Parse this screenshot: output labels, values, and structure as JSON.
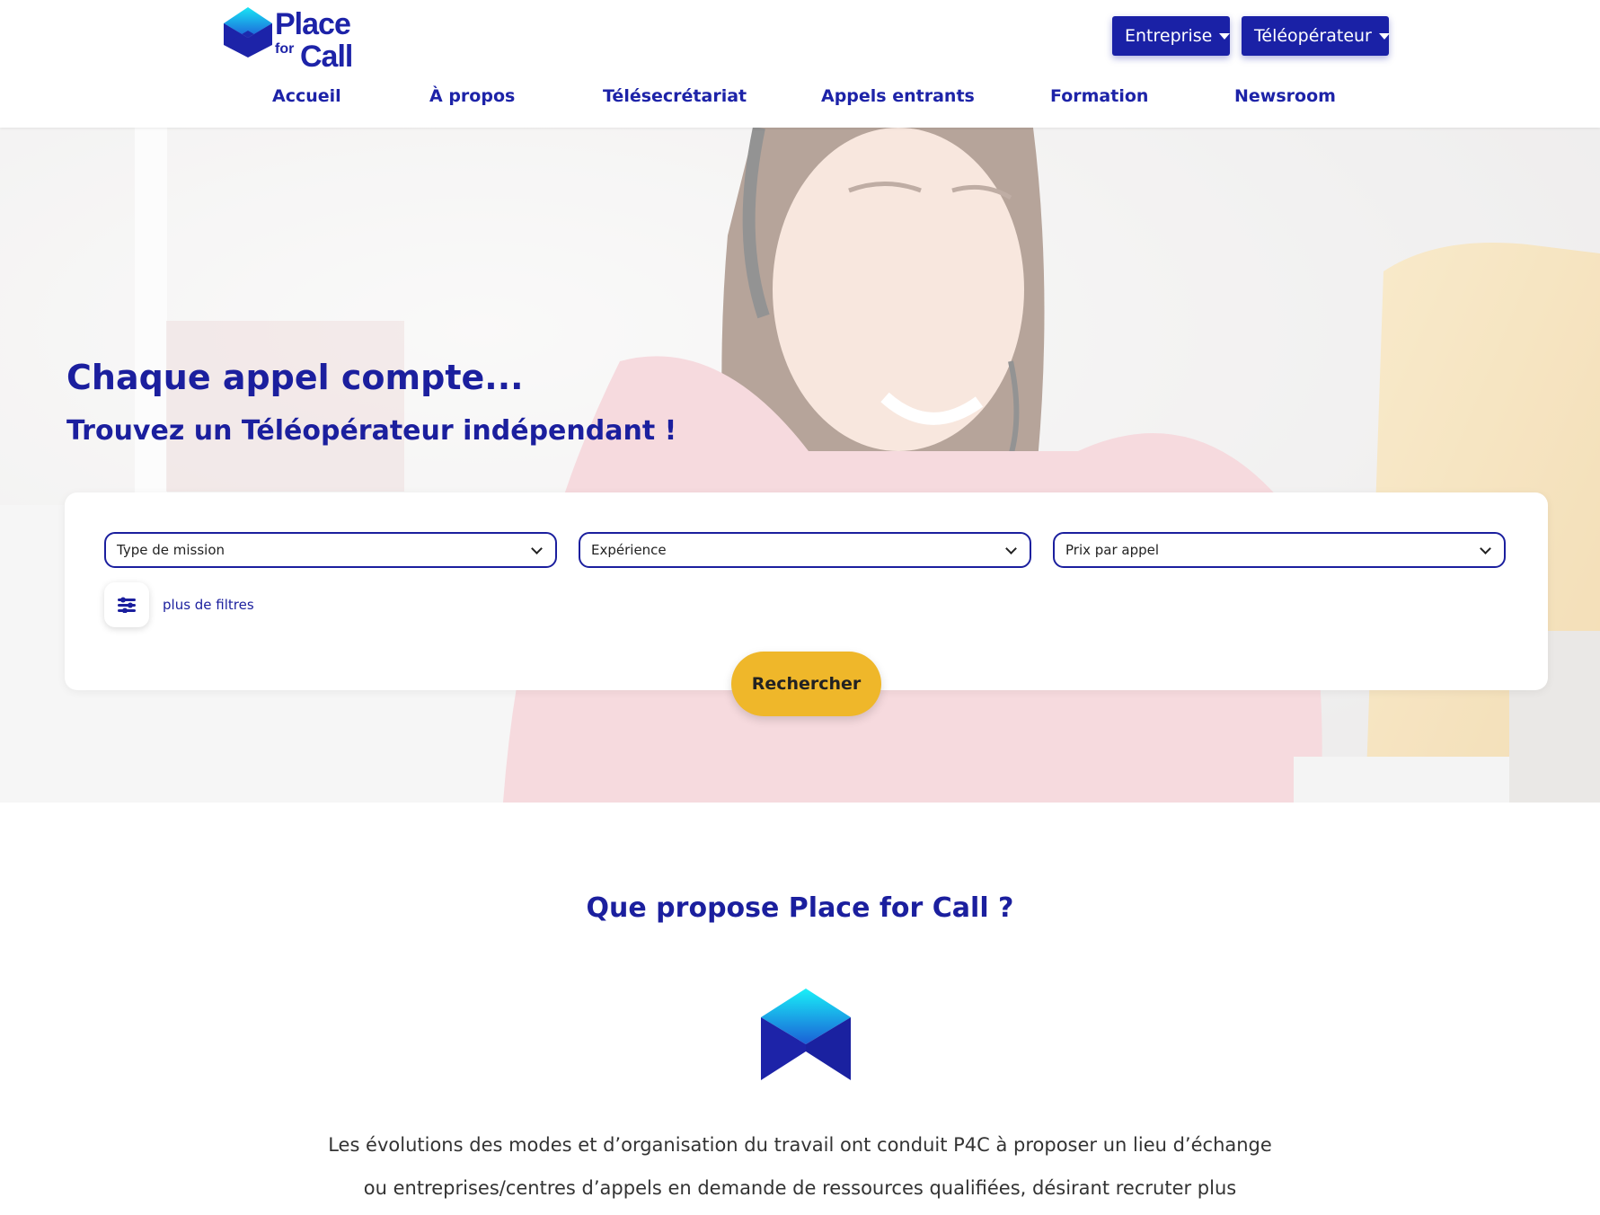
{
  "brand": {
    "line1": "Place",
    "for": "for",
    "line2": "Call",
    "accent_color": "#1b1f9e",
    "cyan_color": "#19e6f5",
    "button_color": "#efb72a"
  },
  "header": {
    "dropdowns": [
      {
        "label": "Entreprise",
        "icon": "caret-down-icon"
      },
      {
        "label": "Téléopérateur",
        "icon": "caret-down-icon"
      }
    ],
    "nav": [
      {
        "label": "Accueil"
      },
      {
        "label": "À propos"
      },
      {
        "label": "Télésecrétariat"
      },
      {
        "label": "Appels entrants"
      },
      {
        "label": "Formation"
      },
      {
        "label": "Newsroom"
      }
    ]
  },
  "hero": {
    "title": "Chaque appel compte...",
    "subtitle": "Trouvez un Téléopérateur indépendant !"
  },
  "search": {
    "selects": [
      {
        "value": "Type de mission"
      },
      {
        "value": "Expérience"
      },
      {
        "value": "Prix par appel"
      }
    ],
    "more_filters_label": "plus de filtres",
    "filters_icon": "sliders-icon",
    "submit_label": "Rechercher"
  },
  "about": {
    "title": "Que propose Place for Call ?",
    "paragraph_lines": [
      "Les évolutions des modes et d’organisation du travail ont conduit P4C à proposer un lieu d’échange",
      "ou entreprises/centres d’appels en demande de ressources qualifiées, désirant recruter plus"
    ]
  }
}
